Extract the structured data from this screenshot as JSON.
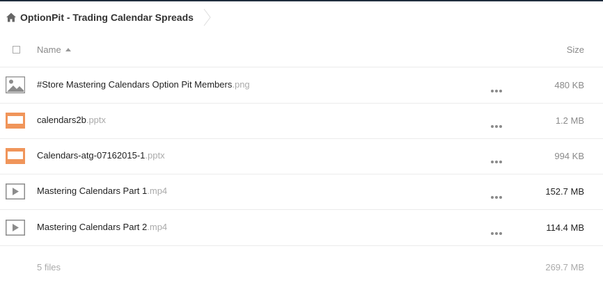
{
  "breadcrumb": {
    "folder": "OptionPit - Trading Calendar Spreads"
  },
  "header": {
    "name_label": "Name",
    "size_label": "Size"
  },
  "files": [
    {
      "name": "#Store Mastering Calendars Option Pit Members",
      "ext": ".png",
      "size": "480 KB",
      "icon": "image-icon"
    },
    {
      "name": "calendars2b",
      "ext": ".pptx",
      "size": "1.2 MB",
      "icon": "presentation-icon"
    },
    {
      "name": "Calendars-atg-07162015-1",
      "ext": ".pptx",
      "size": "994 KB",
      "icon": "presentation-icon"
    },
    {
      "name": "Mastering Calendars Part 1",
      "ext": ".mp4",
      "size": "152.7 MB",
      "icon": "video-icon"
    },
    {
      "name": "Mastering Calendars Part 2",
      "ext": ".mp4",
      "size": "114.4 MB",
      "icon": "video-icon"
    }
  ],
  "summary": {
    "count": "5 files",
    "total": "269.7 MB"
  },
  "colors": {
    "presentation": "#f0955a",
    "icon_gray": "#8c8c8c",
    "topbar": "#1f2d3d"
  }
}
